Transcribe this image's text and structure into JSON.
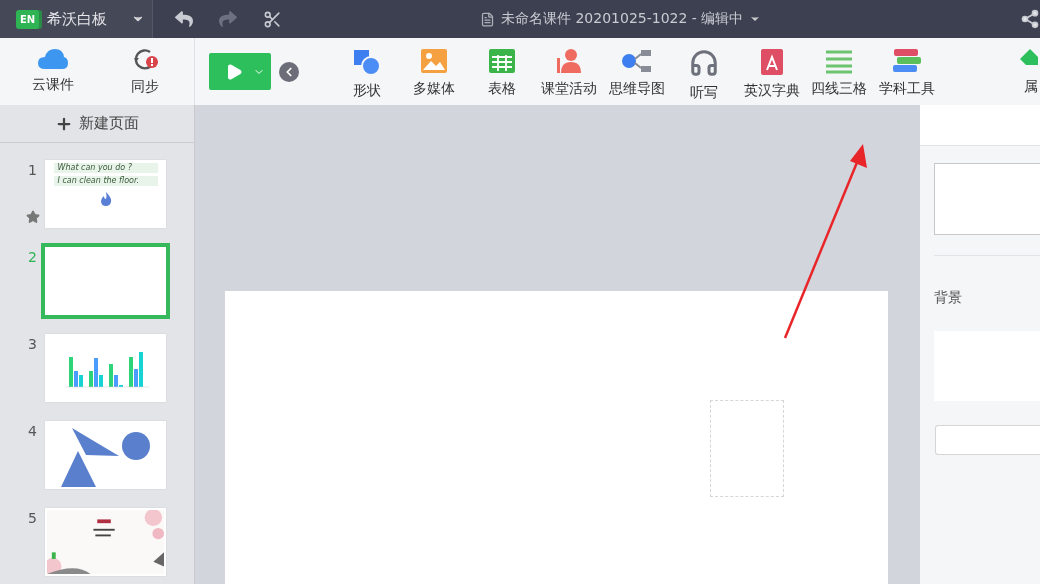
{
  "app": {
    "name": "希沃白板",
    "logo": "EN"
  },
  "document": {
    "title": "未命名课件 20201025-1022 - 编辑中"
  },
  "history": {
    "undo_disabled": false,
    "redo_disabled": true
  },
  "toolbar": {
    "left": [
      {
        "label": "云课件"
      },
      {
        "label": "同步",
        "alert": true
      }
    ],
    "tools": [
      {
        "label": "形状"
      },
      {
        "label": "多媒体"
      },
      {
        "label": "表格"
      },
      {
        "label": "课堂活动"
      },
      {
        "label": "思维导图"
      },
      {
        "label": "听写"
      },
      {
        "label": "英汉字典"
      },
      {
        "label": "四线三格"
      },
      {
        "label": "学科工具"
      }
    ],
    "right": {
      "label": "属"
    }
  },
  "pages": {
    "add_label": "新建页面",
    "items": [
      {
        "number": "1",
        "kind": "text",
        "selected": false,
        "starred": true,
        "lines": [
          "What can you do ?",
          "I can clean the floor."
        ]
      },
      {
        "number": "2",
        "kind": "blank",
        "selected": true,
        "starred": false
      },
      {
        "number": "3",
        "kind": "chart",
        "selected": false,
        "starred": false
      },
      {
        "number": "4",
        "kind": "shapes",
        "selected": false,
        "starred": false
      },
      {
        "number": "5",
        "kind": "picture",
        "selected": false,
        "starred": false
      }
    ]
  },
  "properties": {
    "background_label": "背景"
  }
}
